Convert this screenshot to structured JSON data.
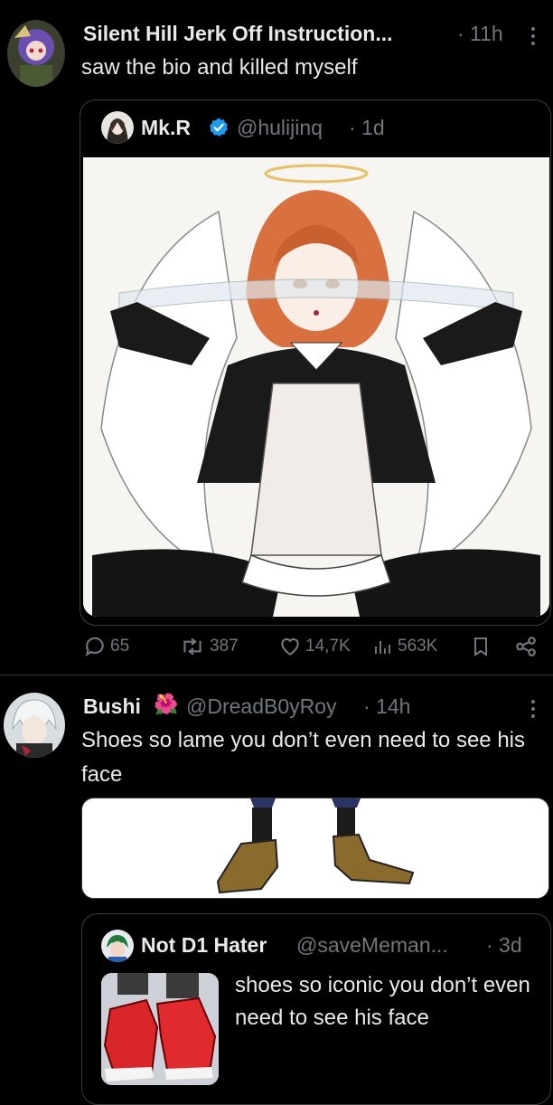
{
  "post1": {
    "author": "Silent Hill Jerk Off Instruction...",
    "time": "· 11h",
    "text": "saw the bio and killed myself",
    "quote": {
      "author": "Mk.R",
      "handle": "@hulijinq",
      "time": "· 1d"
    },
    "actions": {
      "replies": "65",
      "reposts": "387",
      "likes": "14,7K",
      "views": "563K"
    }
  },
  "post2": {
    "author": "Bushi",
    "author_emoji": "🌺",
    "handle": "@DreadB0yRoy",
    "time": "· 14h",
    "text": "Shoes so lame you don’t even need to see his face",
    "quote": {
      "author": "Not D1 Hater",
      "handle": "@saveMeman...",
      "time": "· 3d",
      "text": "shoes so iconic you don’t even need to see his face"
    }
  },
  "icons": {
    "reply": "reply-icon",
    "repost": "repost-icon",
    "like": "heart-icon",
    "views": "views-icon",
    "bookmark": "bookmark-icon",
    "share": "share-icon",
    "verified": "verified-badge-icon",
    "more": "more-options-icon"
  },
  "colors": {
    "background": "#000000",
    "text": "#e7e9ea",
    "muted": "#71767b",
    "verified": "#1d9bf0"
  }
}
